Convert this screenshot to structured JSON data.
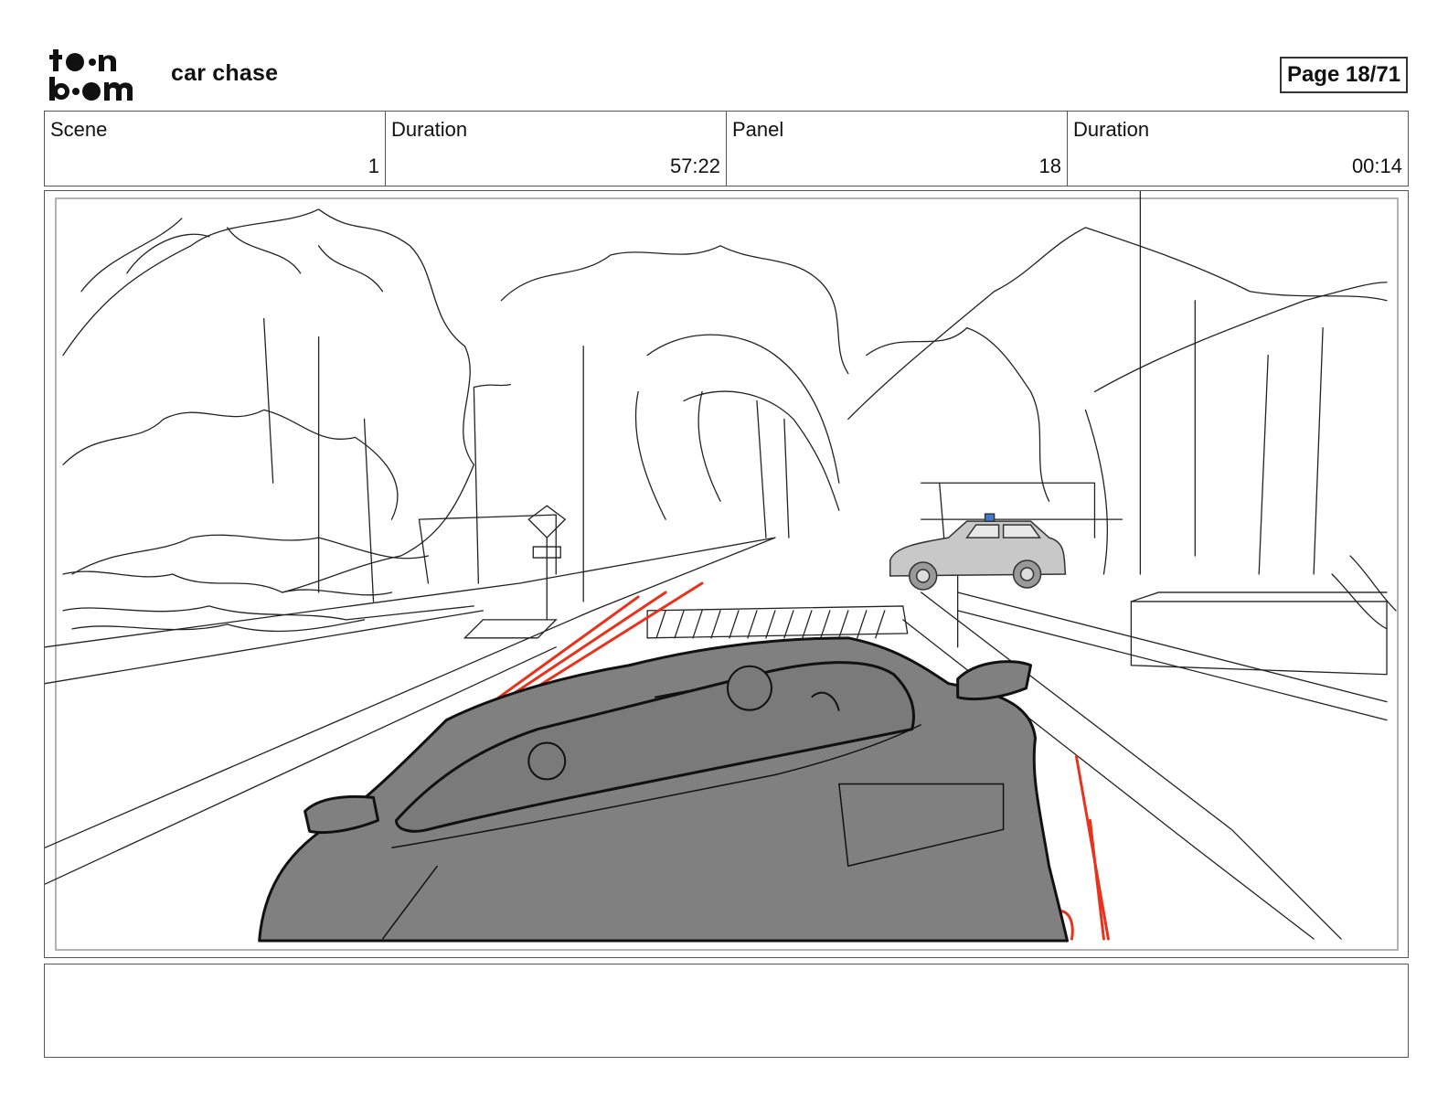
{
  "header": {
    "logo_text": "toon boom",
    "project_title": "car chase",
    "page_label": "Page 18/71"
  },
  "info": {
    "scene_label": "Scene",
    "scene_value": "1",
    "scene_duration_label": "Duration",
    "scene_duration_value": "57:22",
    "panel_label": "Panel",
    "panel_value": "18",
    "panel_duration_label": "Duration",
    "panel_duration_value": "00:14"
  },
  "panel": {
    "description": "",
    "colors": {
      "sketch_line": "#222222",
      "car_fill": "#808080",
      "police_car_fill": "#c8c8c8",
      "speed_lines": "#e8321c",
      "siren": "#3d7bd8"
    }
  },
  "caption": {
    "text": ""
  }
}
